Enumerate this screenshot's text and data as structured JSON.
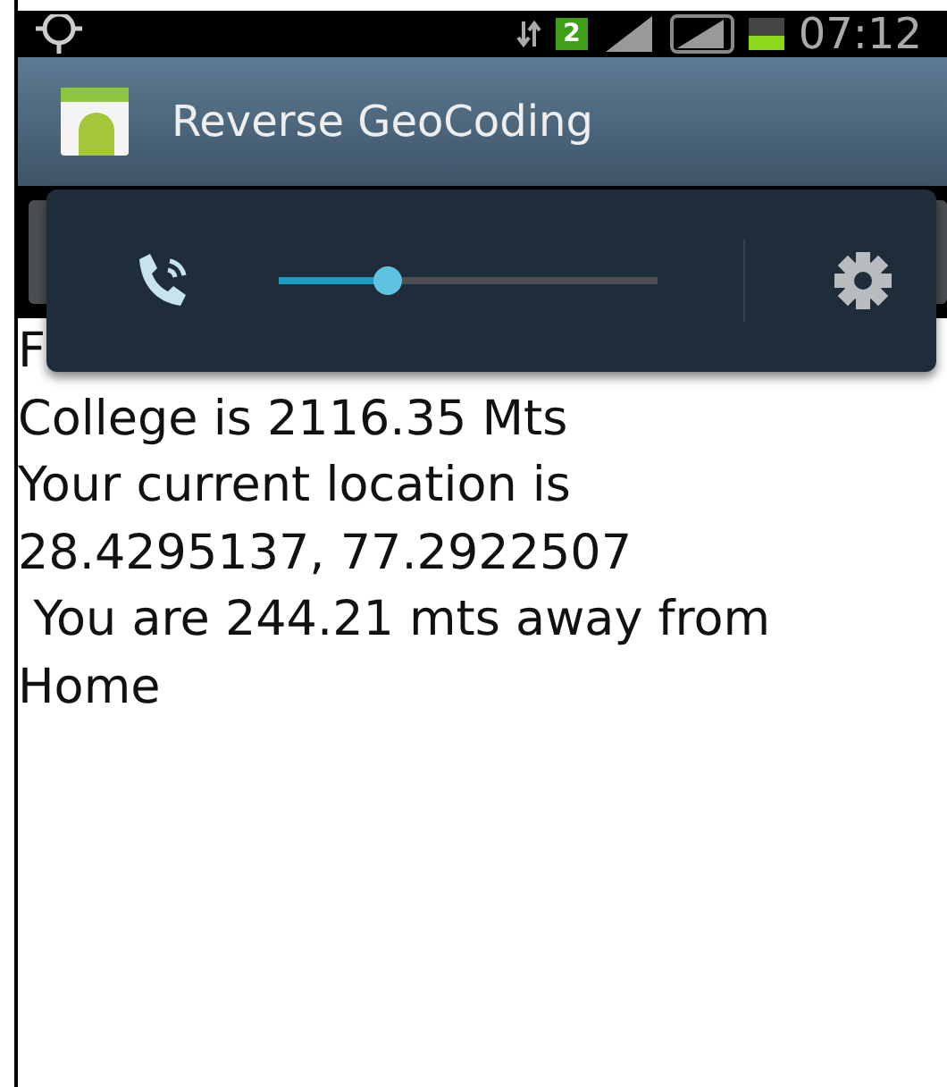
{
  "status_bar": {
    "badge": "2",
    "time": "07:12"
  },
  "action_bar": {
    "title": "Reverse GeoCoding"
  },
  "volume_panel": {
    "level": 0.29
  },
  "content": {
    "lines": [
      "F",
      "College is 2116.35 Mts",
      "Your current location is",
      "28.4295137, 77.2922507",
      " You are 244.21 mts away from",
      "Home"
    ]
  }
}
